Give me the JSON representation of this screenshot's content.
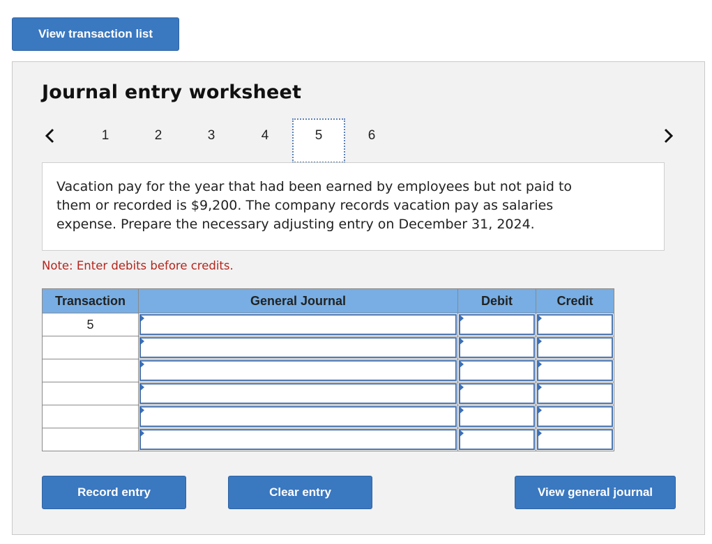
{
  "top": {
    "view_transaction_list": "View transaction list"
  },
  "worksheet": {
    "title": "Journal entry worksheet",
    "pages": [
      "1",
      "2",
      "3",
      "4",
      "5",
      "6"
    ],
    "current_page": "5",
    "description": "Vacation pay for the year that had been earned by employees but not paid to them or recorded is $9,200. The company records vacation pay as salaries expense. Prepare the necessary adjusting entry on December 31, 2024.",
    "note": "Note: Enter debits before credits."
  },
  "table": {
    "headers": {
      "transaction": "Transaction",
      "general_journal": "General Journal",
      "debit": "Debit",
      "credit": "Credit"
    },
    "rows": [
      {
        "transaction": "5",
        "account": "",
        "debit": "",
        "credit": ""
      },
      {
        "transaction": "",
        "account": "",
        "debit": "",
        "credit": ""
      },
      {
        "transaction": "",
        "account": "",
        "debit": "",
        "credit": ""
      },
      {
        "transaction": "",
        "account": "",
        "debit": "",
        "credit": ""
      },
      {
        "transaction": "",
        "account": "",
        "debit": "",
        "credit": ""
      },
      {
        "transaction": "",
        "account": "",
        "debit": "",
        "credit": ""
      }
    ]
  },
  "buttons": {
    "record": "Record entry",
    "clear": "Clear entry",
    "view_general_journal": "View general journal"
  },
  "colors": {
    "button": "#3a78c0",
    "header": "#78aee3",
    "note": "#b5251c",
    "panel": "#f2f2f2"
  },
  "icons": {
    "prev": "chevron-left-icon",
    "next": "chevron-right-icon",
    "input_marker": "triangle-right-icon"
  }
}
